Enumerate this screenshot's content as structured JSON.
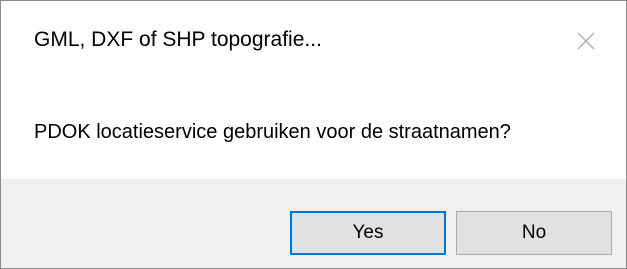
{
  "window": {
    "title": "GML, DXF of SHP topografie...",
    "close_icon": "close-icon"
  },
  "message": {
    "text": "PDOK locatieservice gebruiken voor de straatnamen?"
  },
  "buttons": {
    "yes_label": "Yes",
    "no_label": "No",
    "default_button": "yes",
    "focus_color": "#0078d7"
  }
}
